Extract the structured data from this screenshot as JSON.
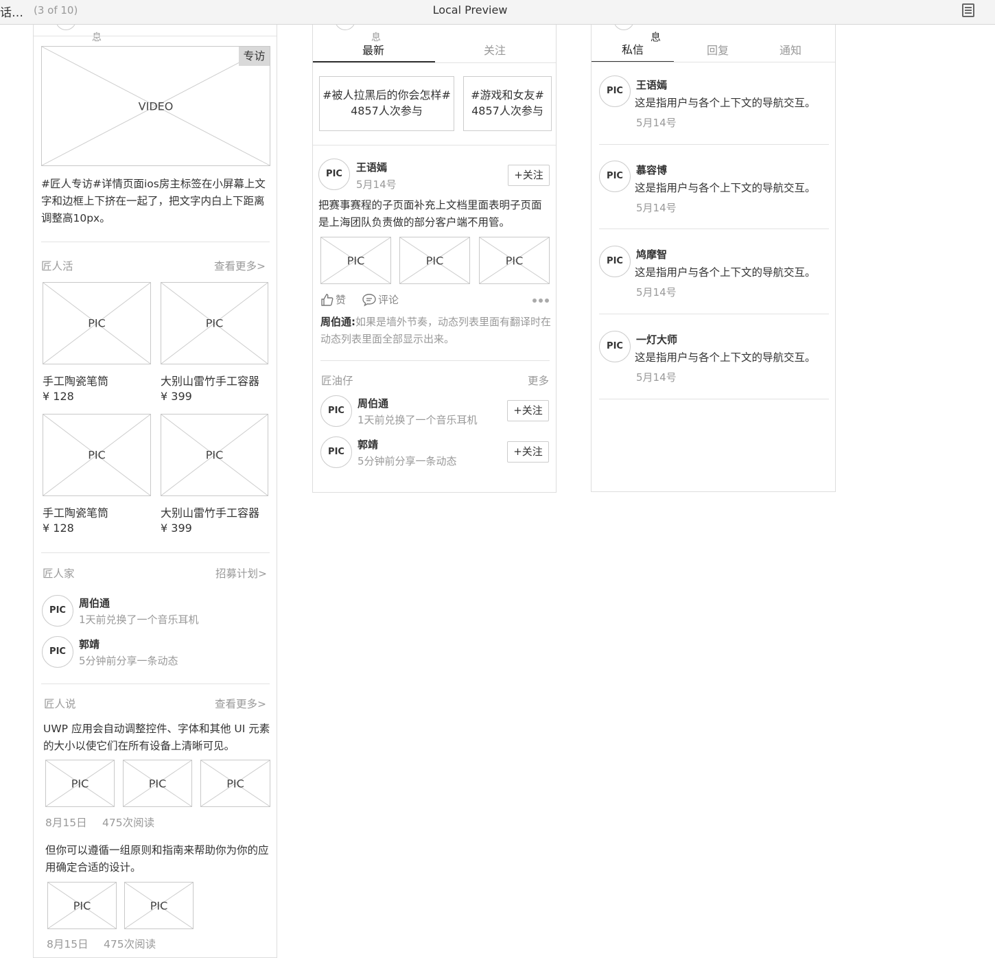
{
  "topbar": {
    "left_title": "话…",
    "page_count": "(3 of 10)",
    "title": "Local Preview"
  },
  "panel1": {
    "header_partial": "息",
    "video_badge": "专访",
    "video_label": "VIDEO",
    "article_text": "#匠人专访#详情页面ios房主标签在小屏幕上文字和边框上下挤在一起了，把文字内白上下距离调整高10px。",
    "section_products": {
      "title": "匠人活",
      "more": "查看更多>"
    },
    "products": [
      {
        "pic": "PIC",
        "name": "手工陶瓷笔筒",
        "price": "¥ 128"
      },
      {
        "pic": "PIC",
        "name": "大别山雷竹手工容器",
        "price": "¥ 399"
      },
      {
        "pic": "PIC",
        "name": "手工陶瓷笔筒",
        "price": "¥ 128"
      },
      {
        "pic": "PIC",
        "name": "大别山雷竹手工容器",
        "price": "¥ 399"
      }
    ],
    "section_family": {
      "title": "匠人家",
      "more": "招募计划>"
    },
    "family": [
      {
        "avatar": "PIC",
        "name": "周伯通",
        "desc": "1天前兑换了一个音乐耳机"
      },
      {
        "avatar": "PIC",
        "name": "郭靖",
        "desc": "5分钟前分享一条动态"
      }
    ],
    "section_talk": {
      "title": "匠人说",
      "more": "查看更多>"
    },
    "talks": [
      {
        "text": "UWP 应用会自动调整控件、字体和其他 UI 元素的大小以使它们在所有设备上清晰可见。",
        "pics": [
          "PIC",
          "PIC",
          "PIC"
        ],
        "date": "8月15日",
        "reads": "475次阅读"
      },
      {
        "text": "但你可以遵循一组原则和指南来帮助你为你的应用确定合适的设计。",
        "pics": [
          "PIC",
          "PIC"
        ],
        "date": "8月15日",
        "reads": "475次阅读"
      }
    ]
  },
  "panel2": {
    "header_partial": "息",
    "tabs": [
      {
        "label": "最新",
        "active": true
      },
      {
        "label": "关注",
        "active": false
      }
    ],
    "topics": [
      {
        "tag": "#被人拉黑后的你会怎样#",
        "count": "4857人次参与"
      },
      {
        "tag": "#游戏和女友#",
        "count": "4857人次参与"
      }
    ],
    "post": {
      "avatar": "PIC",
      "name": "王语嫣",
      "date": "5月14号",
      "follow": "+关注",
      "text": "把赛事赛程的子页面补充上文档里面表明子页面是上海团队负责做的部分客户端不用管。",
      "pics": [
        "PIC",
        "PIC",
        "PIC"
      ],
      "like": "赞",
      "comment": "评论",
      "reply_name": "周伯通:",
      "reply_text": "如果是墙外节奏，动态列表里面有翻译时在动态列表里面全部显示出来。"
    },
    "section_fans": {
      "title": "匠油仔",
      "more": "更多"
    },
    "fans": [
      {
        "avatar": "PIC",
        "name": "周伯通",
        "desc": "1天前兑换了一个音乐耳机",
        "follow": "+关注"
      },
      {
        "avatar": "PIC",
        "name": "郭靖",
        "desc": "5分钟前分享一条动态",
        "follow": "+关注"
      }
    ]
  },
  "panel3": {
    "header_partial": "息",
    "tabs": [
      {
        "label": "私信",
        "active": true
      },
      {
        "label": "回复",
        "active": false
      },
      {
        "label": "通知",
        "active": false
      }
    ],
    "messages": [
      {
        "avatar": "PIC",
        "name": "王语嫣",
        "text": "这是指用户与各个上下文的导航交互。",
        "date": "5月14号"
      },
      {
        "avatar": "PIC",
        "name": "慕容博",
        "text": "这是指用户与各个上下文的导航交互。",
        "date": "5月14号"
      },
      {
        "avatar": "PIC",
        "name": "鸠摩智",
        "text": "这是指用户与各个上下文的导航交互。",
        "date": "5月14号"
      },
      {
        "avatar": "PIC",
        "name": "一灯大师",
        "text": "这是指用户与各个上下文的导航交互。",
        "date": "5月14号"
      }
    ]
  },
  "colors": {
    "accent": "#333333",
    "muted": "#999999",
    "border": "#dddddd"
  }
}
